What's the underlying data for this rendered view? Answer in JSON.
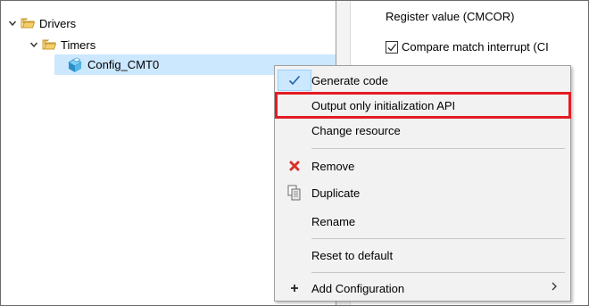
{
  "tree": {
    "items": [
      {
        "label": "Drivers",
        "icon": "folder-open-icon",
        "expanded": true
      },
      {
        "label": "Timers",
        "icon": "folder-open-icon",
        "expanded": true
      },
      {
        "label": "Config_CMT0",
        "icon": "component-icon",
        "selected": true
      }
    ]
  },
  "properties": {
    "register_label": "Register value (CMCOR)",
    "compare_checkbox_label": "Compare match interrupt (CI",
    "compare_checked": true
  },
  "context_menu": {
    "items": [
      {
        "label": "Generate code",
        "icon": "checkmark-icon",
        "checked": true
      },
      {
        "label": "Output only initialization API",
        "highlighted": true
      },
      {
        "label": "Change resource"
      },
      {
        "label": "Remove",
        "icon": "red-x-icon"
      },
      {
        "label": "Duplicate",
        "icon": "duplicate-icon"
      },
      {
        "label": "Rename"
      },
      {
        "label": "Reset to default"
      },
      {
        "label": "Add Configuration",
        "icon": "plus-icon",
        "submenu": true
      }
    ]
  },
  "colors": {
    "selection": "#cce8ff",
    "highlight_border": "#e31c23",
    "menu_bg": "#f2f2f2",
    "folder": "#e8b84a",
    "remove_icon": "#d9302c"
  }
}
